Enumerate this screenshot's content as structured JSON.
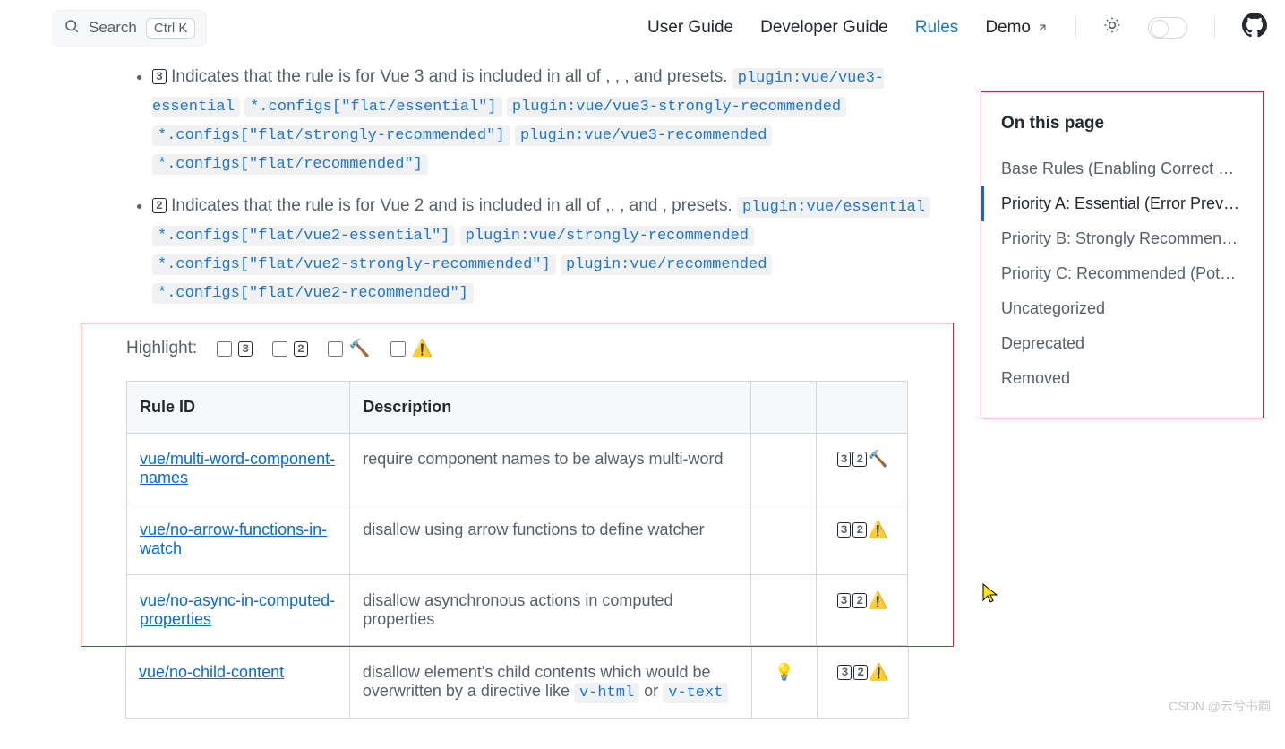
{
  "nav": {
    "search_placeholder": "Search",
    "kbd": "Ctrl K",
    "items": [
      "User Guide",
      "Developer Guide",
      "Rules",
      "Demo"
    ],
    "active_index": 2
  },
  "legend": {
    "item3": {
      "icon_text": "3",
      "lead": " Indicates that the rule is for Vue 3 and is included in all of , , , and ",
      "presets": [
        "plugin:vue/vue3-essential",
        "*.configs[\"flat/essential\"]",
        "plugin:vue/vue3-strongly-recommended",
        "*.configs[\"flat/strongly-recommended\"]",
        "plugin:vue/vue3-recommended",
        "*.configs[\"flat/recommended\"]"
      ]
    },
    "item2": {
      "icon_text": "2",
      "lead": " Indicates that the rule is for Vue 2 and is included in all of ,, , and , presets. ",
      "presets": [
        "plugin:vue/essential",
        "*.configs[\"flat/vue2-essential\"]",
        "plugin:vue/strongly-recommended",
        "*.configs[\"flat/vue2-strongly-recommended\"]",
        "plugin:vue/recommended",
        "*.configs[\"flat/vue2-recommended\"]"
      ]
    }
  },
  "highlight": {
    "label": "Highlight:",
    "options": [
      {
        "icon": "3",
        "type": "box"
      },
      {
        "icon": "2",
        "type": "box"
      },
      {
        "icon": "🔨",
        "type": "emoji"
      },
      {
        "icon": "⚠️",
        "type": "emoji"
      }
    ]
  },
  "table": {
    "headers": [
      "Rule ID",
      "Description",
      "",
      ""
    ],
    "rows_in_box": [
      {
        "id": "vue/multi-word-component-names",
        "desc": "require component names to be always multi-word",
        "fix": "",
        "badges": [
          "3",
          "2",
          "🔨"
        ]
      },
      {
        "id": "vue/no-arrow-functions-in-watch",
        "desc": "disallow using arrow functions to define watcher",
        "fix": "",
        "badges": [
          "3",
          "2",
          "⚠️"
        ]
      },
      {
        "id": "vue/no-async-in-computed-properties",
        "desc": "disallow asynchronous actions in computed properties",
        "fix": "",
        "badges": [
          "3",
          "2",
          "⚠️"
        ]
      }
    ],
    "rows_below": [
      {
        "id": "vue/no-child-content",
        "desc_parts": [
          "disallow element's child contents which would be overwritten by a directive like ",
          "v-html",
          " or ",
          "v-text"
        ],
        "fix": "💡",
        "badges": [
          "3",
          "2",
          "⚠️"
        ]
      }
    ]
  },
  "aside": {
    "title": "On this page",
    "items": [
      "Base Rules (Enabling Correct ESLint Parsing)",
      "Priority A: Essential (Error Prevention)",
      "Priority B: Strongly Recommended",
      "Priority C: Recommended (Potentially Dangerous Patterns)",
      "Uncategorized",
      "Deprecated",
      "Removed"
    ],
    "active_index": 1
  },
  "watermark": "CSDN @云兮书嗣"
}
